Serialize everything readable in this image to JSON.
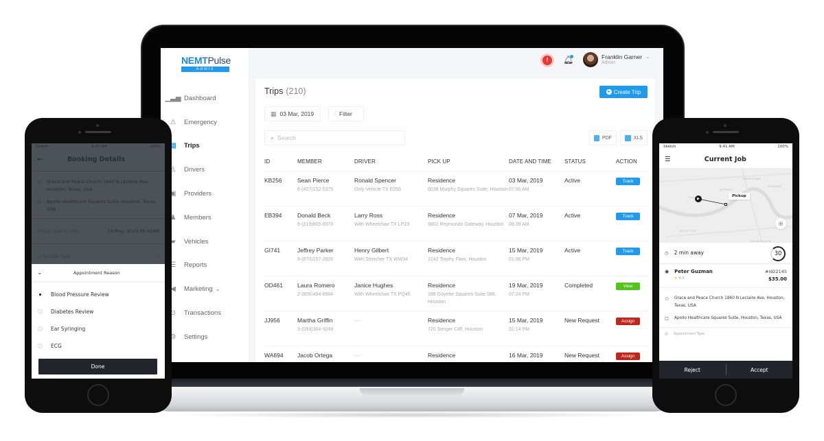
{
  "app": {
    "logo_primary": "NEMT",
    "logo_secondary": "Pulse",
    "logo_badge": "Admin"
  },
  "sidebar": {
    "items": [
      {
        "label": "Dashboard",
        "icon": "bar-chart-icon",
        "active": false
      },
      {
        "label": "Emergency",
        "icon": "siren-icon",
        "active": false
      },
      {
        "label": "Trips",
        "icon": "trips-icon",
        "active": true
      },
      {
        "label": "Drivers",
        "icon": "driver-icon",
        "active": false
      },
      {
        "label": "Providers",
        "icon": "provider-icon",
        "active": false
      },
      {
        "label": "Members",
        "icon": "members-icon",
        "active": false
      },
      {
        "label": "Vehicles",
        "icon": "vehicle-icon",
        "active": false
      },
      {
        "label": "Reports",
        "icon": "report-icon",
        "active": false
      },
      {
        "label": "Marketing",
        "icon": "megaphone-icon",
        "active": false,
        "has_submenu": true
      },
      {
        "label": "Transactions",
        "icon": "transactions-icon",
        "active": false
      },
      {
        "label": "Settings",
        "icon": "gear-icon",
        "active": false
      }
    ]
  },
  "topbar": {
    "alert_icon": "!",
    "user_name": "Franklin Garner",
    "user_role": "Admin"
  },
  "trips": {
    "title": "Trips",
    "count": "(210)",
    "create_label": "Create Trip",
    "date_filter": "03 Mar, 2019",
    "filter_label": "Filter",
    "search_placeholder": "Search",
    "search_value": "",
    "export_pdf": "PDF",
    "export_xls": "XLS",
    "columns": [
      "ID",
      "MEMBER",
      "DRIVER",
      "PICK UP",
      "DATE AND TIME",
      "STATUS",
      "ACTION"
    ],
    "rows": [
      {
        "id": "KB256",
        "member": "Sean Pierce",
        "member_phone": "6-(427)152-5375",
        "driver": "Ronald Spencer",
        "driver_vehicle": "Only Vehicle  TX E056",
        "pickup": "Residence",
        "pickup_address": "6038 Murphy Squares Suite, Houston",
        "date": "03 Mar, 2019",
        "time": "07:00 AM",
        "status": "Active",
        "action": "Track",
        "action_color": "#1e9bf0"
      },
      {
        "id": "EB394",
        "member": "Donald Beck",
        "member_phone": "6-(219)805-0970",
        "driver": "Larry Ross",
        "driver_vehicle": "With Wheelchair  TX LP23",
        "pickup": "Residence",
        "pickup_address": "9802 Reymundo Gateway, Houston",
        "date": "07 Mar, 2019",
        "time": "08:39 AM",
        "status": "Active",
        "action": "Track",
        "action_color": "#1e9bf0"
      },
      {
        "id": "GI741",
        "member": "Jeffrey Parker",
        "member_phone": "8-(870)157-2826",
        "driver": "Henry Gilbert",
        "driver_vehicle": "With Stretcher  TX WW34",
        "pickup": "Residence",
        "pickup_address": "2142 Torphy Flats, Houston",
        "date": "15 Mar, 2019",
        "time": "01:36 PM",
        "status": "Active",
        "action": "Track",
        "action_color": "#1e9bf0"
      },
      {
        "id": "OD461",
        "member": "Laura Romero",
        "member_phone": "2-(806)494-6984",
        "driver": "Janice Hughes",
        "driver_vehicle": "With Wheelchair  TX PQ45",
        "pickup": "Residence",
        "pickup_address": "188 Goyette Squares Suite 088, Houston",
        "date": "19 Mar, 2019",
        "time": "07:24 PM",
        "status": "Completed",
        "action": "View",
        "action_color": "#52c41a"
      },
      {
        "id": "JJ956",
        "member": "Martha Griffin",
        "member_phone": "3-(093)364-3249",
        "driver": "—",
        "driver_vehicle": "",
        "pickup": "Residence",
        "pickup_address": "720 Senger Cliff, Houston",
        "date": "15 Mar, 2019",
        "time": "01:14 PM",
        "status": "New Request",
        "action": "Assign",
        "action_color": "#c0261c"
      },
      {
        "id": "WA694",
        "member": "Jacob Ortega",
        "member_phone": "",
        "driver": "—",
        "driver_vehicle": "",
        "pickup": "Residence",
        "pickup_address": "",
        "date": "16 Mar, 2019",
        "time": "",
        "status": "New Request",
        "action": "Assign",
        "action_color": "#c0261c"
      }
    ]
  },
  "phone_left": {
    "status_carrier": "Sketch",
    "status_time": "9:41 AM",
    "status_battery": "100%",
    "title": "Booking Details",
    "from": "Grace and Peace Church 1860 N Leclaire Ave, Houston, Texas, USA",
    "to": "Apollo Healthcare Squares Suite, Houston, Texas, USA",
    "pickup_label": "Pickup date & time",
    "pickup_value": "19 May, 2019 09:41AM",
    "vehicle_label": "Vehicle Type",
    "sheet_title": "Appointment Reason",
    "options": [
      {
        "label": "Blood Pressure Review",
        "selected": true
      },
      {
        "label": "Diabetes Review",
        "selected": false
      },
      {
        "label": "Ear Syringing",
        "selected": false
      },
      {
        "label": "ECG",
        "selected": false
      }
    ],
    "done_label": "Done"
  },
  "phone_right": {
    "status_carrier": "Sketch",
    "status_time": "9:41 AM",
    "status_battery": "100%",
    "title": "Current Job",
    "map_labels": [
      "EDENTOWN",
      "STANWIX",
      "ATTERBY",
      "Stanwix",
      "BELLE VUE",
      "CALDEWGATE"
    ],
    "pickup_tag": "Pickup",
    "eta": "2 min away",
    "timer": "30",
    "rider_name": "Peter Guzman",
    "rider_rating": "4.3",
    "job_id": "#id22145",
    "price": "$35.00",
    "from": "Grace and Peace Church 1860 N Leclaire Ave, Houston, Texas, USA",
    "to": "Apollo Healthcare Squares Suite, Houston, Texas, USA",
    "appointment_label": "Appointment Type",
    "reject_label": "Reject",
    "accept_label": "Accept"
  }
}
